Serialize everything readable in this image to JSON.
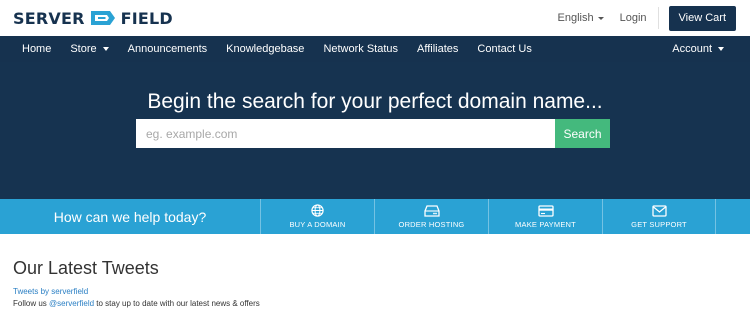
{
  "header": {
    "logo_left": "SERVER",
    "logo_right": "FIELD",
    "language": "English",
    "login": "Login",
    "view_cart": "View Cart"
  },
  "nav": {
    "items": [
      {
        "label": "Home"
      },
      {
        "label": "Store"
      },
      {
        "label": "Announcements"
      },
      {
        "label": "Knowledgebase"
      },
      {
        "label": "Network Status"
      },
      {
        "label": "Affiliates"
      },
      {
        "label": "Contact Us"
      }
    ],
    "account": "Account"
  },
  "hero": {
    "title": "Begin the search for your perfect domain name...",
    "search_placeholder": "eg. example.com",
    "search_button": "Search"
  },
  "help": {
    "prompt": "How can we help today?",
    "actions": [
      {
        "label": "BUY A DOMAIN",
        "icon": "globe-icon"
      },
      {
        "label": "ORDER HOSTING",
        "icon": "server-icon"
      },
      {
        "label": "MAKE PAYMENT",
        "icon": "credit-card-icon"
      },
      {
        "label": "GET SUPPORT",
        "icon": "envelope-icon"
      }
    ]
  },
  "tweets": {
    "title": "Our Latest Tweets",
    "link": "Tweets by serverfield",
    "follow_prefix": "Follow us ",
    "handle": "@serverfield",
    "follow_suffix": " to stay up to date with our latest news & offers"
  },
  "colors": {
    "brand_navy": "#16324f",
    "hero_bg": "#163350",
    "search_green": "#44b97d",
    "help_blue": "#2aa2d4",
    "link_blue": "#2a7fc4"
  }
}
